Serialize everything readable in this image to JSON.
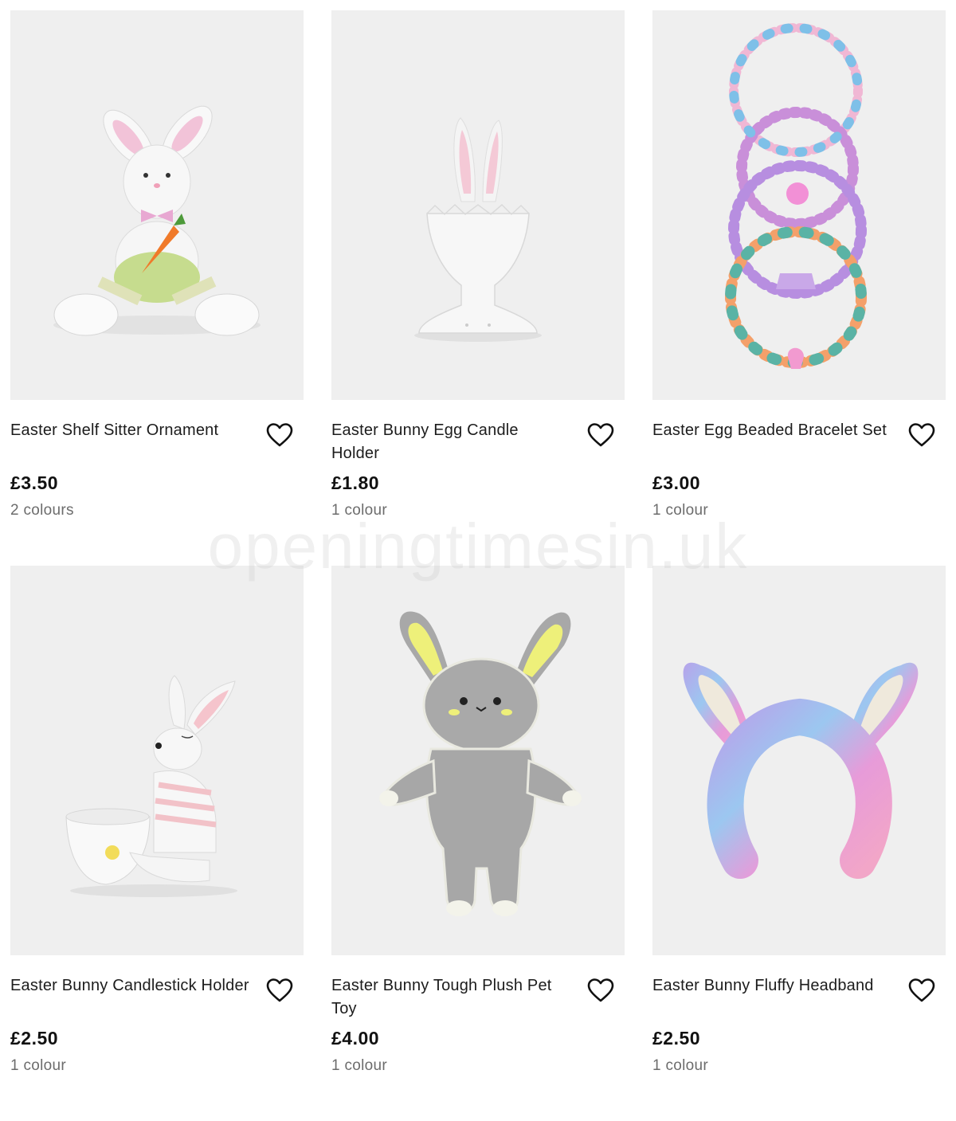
{
  "watermark": "openingtimesin.uk",
  "colors": {
    "image_background": "#efefef",
    "price_text": "#111111",
    "colours_text": "#6c6c6c"
  },
  "products": [
    {
      "title": "Easter Shelf Sitter Ornament",
      "price": "£3.50",
      "colours": "2 colours",
      "image_icon": "bunny-shelf-sitter-image",
      "wishlist_icon": "heart-outline-icon"
    },
    {
      "title": "Easter Bunny Egg Candle Holder",
      "price": "£1.80",
      "colours": "1 colour",
      "image_icon": "bunny-egg-cup-image",
      "wishlist_icon": "heart-outline-icon"
    },
    {
      "title": "Easter Egg Beaded Bracelet Set",
      "price": "£3.00",
      "colours": "1 colour",
      "image_icon": "beaded-bracelets-image",
      "wishlist_icon": "heart-outline-icon"
    },
    {
      "title": "Easter Bunny Candlestick Holder",
      "price": "£2.50",
      "colours": "1 colour",
      "image_icon": "bunny-candlestick-image",
      "wishlist_icon": "heart-outline-icon"
    },
    {
      "title": "Easter Bunny Tough Plush Pet Toy",
      "price": "£4.00",
      "colours": "1 colour",
      "image_icon": "plush-bunny-toy-image",
      "wishlist_icon": "heart-outline-icon"
    },
    {
      "title": "Easter Bunny Fluffy Headband",
      "price": "£2.50",
      "colours": "1 colour",
      "image_icon": "fluffy-headband-image",
      "wishlist_icon": "heart-outline-icon"
    }
  ]
}
